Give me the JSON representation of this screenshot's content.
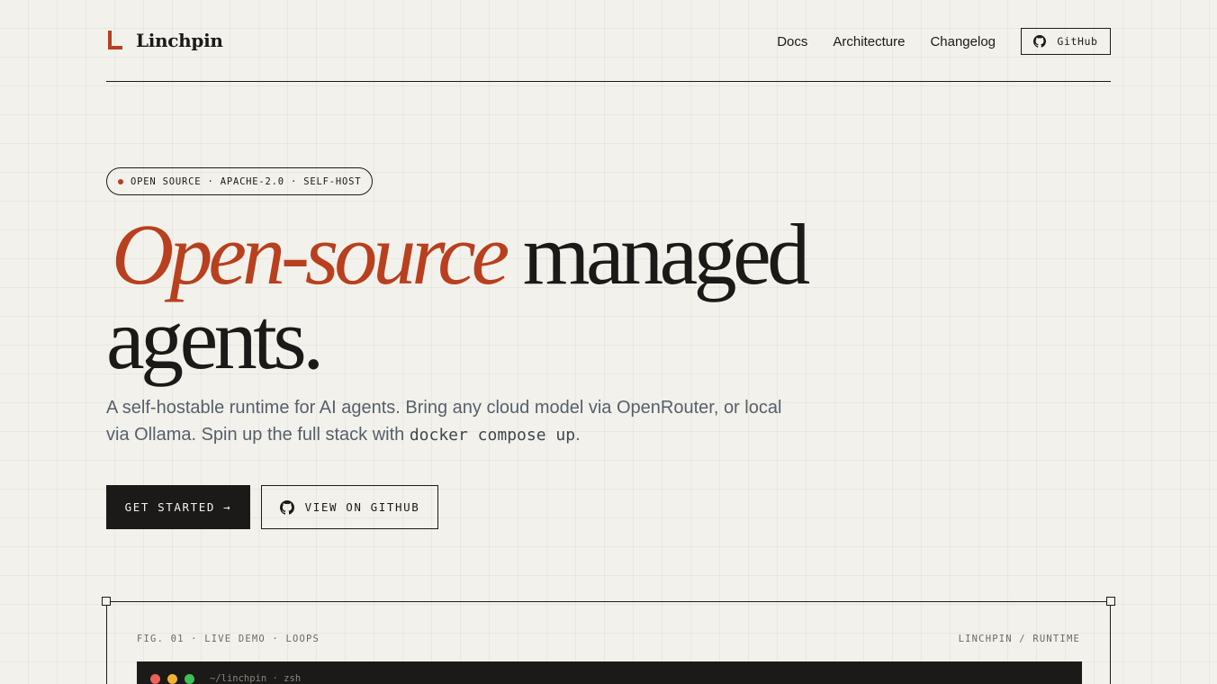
{
  "brand": {
    "name": "Linchpin",
    "accent_color": "#b8401f"
  },
  "nav": {
    "links": [
      "Docs",
      "Architecture",
      "Changelog"
    ],
    "github_label": "GitHub",
    "github_icon": "github-icon"
  },
  "hero": {
    "badge": "OPEN SOURCE · APACHE-2.0 · SELF-HOST",
    "headline_accent": "Open-source",
    "headline_rest": "managed",
    "headline_line2": "agents.",
    "sub_before": "A self-hostable runtime for AI agents. Bring any cloud model via OpenRouter, or local via Ollama. Spin up the full stack with ",
    "sub_code": "docker compose up",
    "sub_after": ".",
    "cta_primary": "GET STARTED →",
    "cta_secondary": "VIEW ON GITHUB"
  },
  "figure": {
    "caption": "FIG. 01 · LIVE DEMO · LOOPS",
    "label": "LINCHPIN / RUNTIME",
    "terminal_title": "~/linchpin · zsh",
    "traffic_lights": [
      "#ed5f57",
      "#f2b233",
      "#3fbf55"
    ]
  }
}
